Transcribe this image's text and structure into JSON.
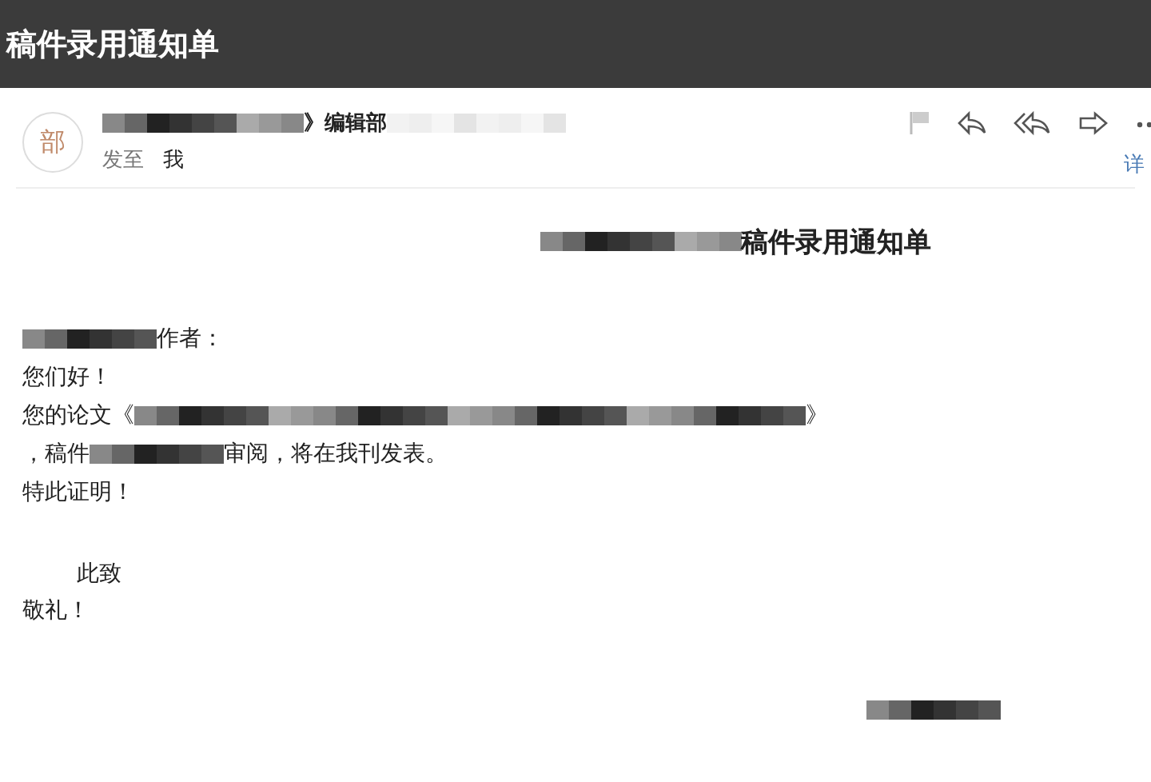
{
  "window": {
    "title": "稿件录用通知单"
  },
  "message": {
    "avatar": "部",
    "sender": [
      {
        "kind": "longblur"
      },
      {
        "kind": "text",
        "text": "》编辑部"
      },
      {
        "kind": "faintblur"
      }
    ],
    "to_label": "发至",
    "to": "我",
    "details_link": "详",
    "heading": [
      {
        "kind": "longblur"
      },
      {
        "kind": "text",
        "text": "稿件录用通知单"
      }
    ],
    "body": [
      [
        {
          "kind": "blur"
        },
        {
          "kind": "text",
          "text": "作者："
        }
      ],
      [
        {
          "kind": "text",
          "text": "您们好！"
        }
      ],
      [
        {
          "kind": "text",
          "text": "您的论文《"
        },
        {
          "kind": "wideblur"
        },
        {
          "kind": "text",
          "text": "》"
        }
      ],
      [
        {
          "kind": "text",
          "text": "，稿件"
        },
        {
          "kind": "blur"
        },
        {
          "kind": "text",
          "text": "审阅，将在我刊发表。"
        }
      ],
      [
        {
          "kind": "text",
          "text": "特此证明！"
        }
      ],
      [
        {
          "kind": "gap"
        },
        {
          "kind": "indent"
        },
        {
          "kind": "text",
          "text": "此致"
        }
      ],
      [
        {
          "kind": "text",
          "text": "敬礼！"
        }
      ]
    ],
    "signature": [
      {
        "kind": "blur"
      }
    ]
  }
}
